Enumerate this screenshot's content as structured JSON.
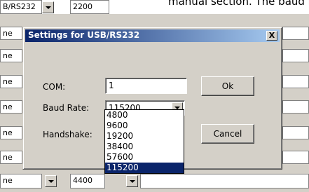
{
  "background": {
    "top_text": "manual section. The baud rate should be s",
    "top_left_text": "B/RS232",
    "top_combo_value": "2200",
    "row_values": [
      "ne",
      "ne",
      "ne",
      "ne",
      "ne",
      "ne",
      "ne",
      "ne"
    ],
    "bottom_combo_value": "4400"
  },
  "dialog": {
    "title": "Settings for USB/RS232",
    "close_label": "X",
    "com_label": "COM:",
    "com_value": "1",
    "baud_label": "Baud Rate:",
    "baud_value": "115200",
    "handshake_label": "Handshake:",
    "ok_label": "Ok",
    "cancel_label": "Cancel"
  },
  "baud_options": [
    "4800",
    "9600",
    "19200",
    "38400",
    "57600",
    "115200"
  ],
  "selected_baud_index": 5,
  "colors": {
    "titlebar": "#0a246a",
    "face": "#d4d0c8",
    "selection": "#0a246a"
  }
}
